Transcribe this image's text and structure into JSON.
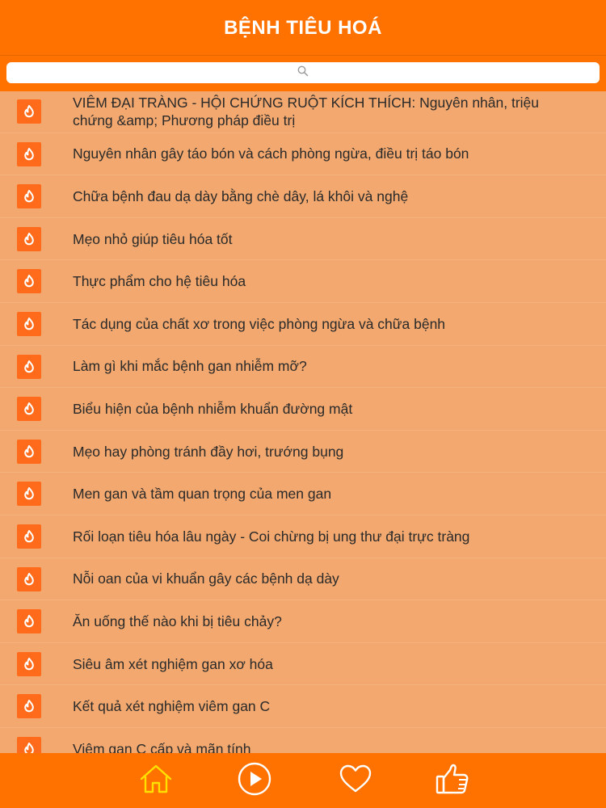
{
  "header": {
    "title": "BỆNH TIÊU HOÁ"
  },
  "search": {
    "icon": "search-icon"
  },
  "list": {
    "items": [
      "VIÊM ĐẠI TRÀNG - HỘI CHỨNG RUỘT KÍCH THÍCH: Nguyên nhân, triệu chứng &amp; Phương pháp điều trị",
      "Nguyên nhân gây táo bón và cách phòng ngừa, điều trị táo bón",
      "Chữa bệnh đau dạ dày bằng chè dây, lá khôi và nghệ",
      "Mẹo nhỏ giúp tiêu hóa tốt",
      "Thực phẩm cho hệ tiêu hóa",
      "Tác dụng của chất xơ trong việc phòng ngừa và chữa bệnh",
      "Làm gì khi mắc bệnh gan nhiễm mỡ?",
      "Biểu hiện của bệnh nhiễm khuẩn đường mật",
      "Mẹo hay phòng tránh đầy hơi, trướng bụng",
      "Men gan và tầm quan trọng của men gan",
      "Rối loạn tiêu hóa lâu ngày - Coi chừng bị ung thư đại trực tràng",
      "Nỗi oan của vi khuẩn gây các bệnh dạ dày",
      "Ăn uống thế nào khi bị tiêu chảy?",
      "Siêu âm xét nghiệm gan xơ hóa",
      "Kết quả xét nghiệm viêm gan C",
      "Viêm gan C cấp và mãn tính"
    ],
    "item_icon": "flame-icon"
  },
  "tabbar": {
    "tabs": [
      {
        "name": "home",
        "icon": "home-icon"
      },
      {
        "name": "play",
        "icon": "play-icon"
      },
      {
        "name": "favorites",
        "icon": "heart-icon"
      },
      {
        "name": "like",
        "icon": "thumbs-up-icon"
      }
    ]
  },
  "colors": {
    "header": "#FF7200",
    "list_background": "#F2A86E",
    "item_icon": "#FF6B1A",
    "text": "#2A2A2A"
  }
}
